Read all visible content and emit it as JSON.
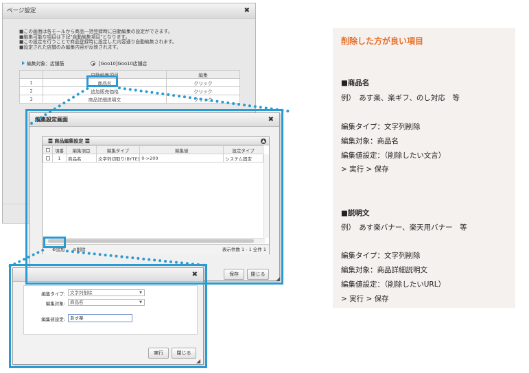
{
  "page_dialog": {
    "title": "ページ設定",
    "close": "✖",
    "notice_lines": [
      "■この画面は各モールから商品一括登録時に自動編集の設定ができます。",
      "■編集可能な項目は下記\"自動編集項目\"となります。",
      "■この設定を行うことで商品登録時に設定した内容通り自動編集されます。",
      "■設定された店舗のみ編集内容が反映されます。"
    ],
    "target_label": "編集対象：店舗筋",
    "target_shop": "[Goo10]Goo10店舗店",
    "columns": [
      "",
      "自動編集項目",
      "編集"
    ],
    "rows": [
      {
        "no": "1",
        "item": "商品名",
        "action": "クリック"
      },
      {
        "no": "2",
        "item": "追加販売価格",
        "action": "クリック"
      },
      {
        "no": "3",
        "item": "商品詳細説明文",
        "action": "クリック"
      }
    ]
  },
  "edit_dialog": {
    "title": "編集設定画面",
    "close": "✖",
    "panel_title": "〓 商品編集設定 〓",
    "collapse_icon": "▲",
    "columns": [
      "",
      "項番",
      "編集項目",
      "編集タイプ",
      "編集値",
      "設定タイプ"
    ],
    "rows": [
      {
        "no": "1",
        "item": "商品名",
        "type": "文字列切取り(BYTE)",
        "value": "0->200",
        "setting": "システム固定"
      }
    ],
    "add_label": "追加",
    "delete_label": "削除",
    "count_text": "表示件数 1 - 1 全件 1",
    "save_label": "保存",
    "close_label": "閉じる"
  },
  "value_dialog": {
    "close": "✖",
    "type_label": "編集タイプ:",
    "type_value": "文字列削除",
    "target_label": "編集対象:",
    "target_value": "商品名",
    "value_label": "編集値設定:",
    "value_value": "あす楽",
    "run_label": "実行",
    "close_label": "閉じる"
  },
  "info": {
    "title": "削除した方が良い項目",
    "section1_title": "■商品名",
    "section1_example": "例）　あす楽、楽ギフ、のし対応　等",
    "section1_type": "編集タイプ：文字列削除",
    "section1_target": "編集対象：商品名",
    "section1_value": "編集値設定：（削除したい文言）",
    "section1_action": "> 実行 > 保存",
    "section2_title": "■説明文",
    "section2_example": "例）　あす楽バナー、楽天用バナー　等",
    "section2_type": "編集タイプ：文字列削除",
    "section2_target": "編集対象：商品詳細説明文",
    "section2_value": "編集値設定：（削除したいURL）",
    "section2_action": "> 実行 > 保存"
  },
  "colors": {
    "accent": "#2a9bd2",
    "title_orange": "#e8702a",
    "panel_bg": "#f5f1ee"
  }
}
